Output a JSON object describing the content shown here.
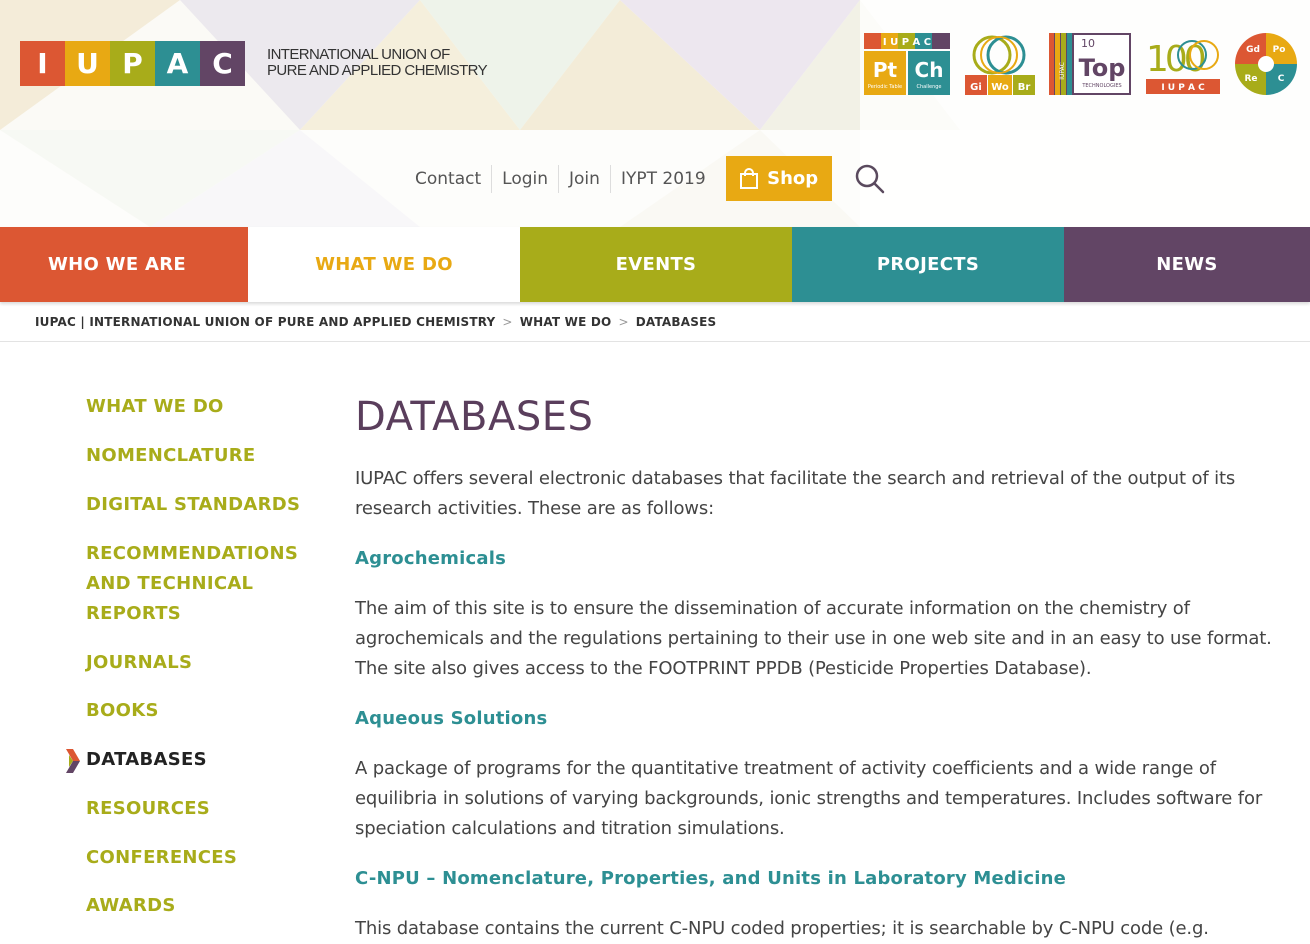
{
  "brand": {
    "letters": [
      "I",
      "U",
      "P",
      "A",
      "C"
    ],
    "letter_colors": [
      "#dc5733",
      "#e8a913",
      "#a8ac1a",
      "#2d8f93",
      "#624565"
    ],
    "tagline_line1": "INTERNATIONAL UNION OF",
    "tagline_line2": "PURE AND APPLIED CHEMISTRY"
  },
  "badges": {
    "ptch": {
      "top": "I U P A C",
      "pt": "Pt",
      "ch": "Ch",
      "pt_sub": "Periodic Table",
      "ch_sub": "Challenge"
    },
    "gwb": {
      "g": "Gi",
      "w": "Wo",
      "b": "Br"
    },
    "top10": {
      "num": "10",
      "word": "Top",
      "side": "IUPAC",
      "sub": "TECHNOLOGIES"
    },
    "centenary": {
      "digits": "100",
      "sub": "I U P A C"
    },
    "gdporec": {
      "gd": "Gd",
      "po": "Po",
      "re": "Re",
      "c": "C"
    }
  },
  "topnav": {
    "links": [
      "Contact",
      "Login",
      "Join",
      "IYPT 2019"
    ],
    "shop_label": "Shop"
  },
  "mainnav": {
    "who": "WHO WE ARE",
    "what": "WHAT WE DO",
    "events": "EVENTS",
    "projects": "PROJECTS",
    "news": "NEWS"
  },
  "breadcrumb": {
    "home": "IUPAC | INTERNATIONAL UNION OF PURE AND APPLIED CHEMISTRY",
    "sep": ">",
    "level1": "WHAT WE DO",
    "current": "DATABASES"
  },
  "sidebar": {
    "items": [
      {
        "label": "WHAT WE DO"
      },
      {
        "label": "NOMENCLATURE"
      },
      {
        "label": "DIGITAL STANDARDS"
      },
      {
        "label_lines": [
          "RECOMMENDATIONS",
          "AND TECHNICAL",
          "REPORTS"
        ]
      },
      {
        "label": "JOURNALS"
      },
      {
        "label": "BOOKS"
      },
      {
        "label": "DATABASES"
      },
      {
        "label": "RESOURCES"
      },
      {
        "label": "CONFERENCES"
      },
      {
        "label": "AWARDS"
      }
    ]
  },
  "content": {
    "title": "DATABASES",
    "intro": "IUPAC offers several electronic databases that facilitate the search and retrieval of the output of its research activities. These are as follows:",
    "sections": [
      {
        "title": "Agrochemicals",
        "text": "The aim of this site is to ensure the dissemination of accurate information on the chemistry of agrochemicals and the regulations pertaining to their use in one web site and in an easy to use format. The site also gives access to the FOOTPRINT PPDB (Pesticide Properties Database)."
      },
      {
        "title": "Aqueous Solutions",
        "text": "A package of programs for the quantitative treatment of activity coefficients and a wide range of equilibria in solutions of varying backgrounds, ionic strengths and temperatures. Includes software for speciation calculations and titration simulations."
      },
      {
        "title": "C-NPU – Nomenclature, Properties, and Units in Laboratory Medicine",
        "text": "This database contains the current C-NPU coded properties; it is searchable by C-NPU code (e.g."
      }
    ]
  },
  "icons": {
    "shop": "shopping-bag-icon",
    "search": "search-icon",
    "active_marker": "chevron-marker-icon"
  }
}
